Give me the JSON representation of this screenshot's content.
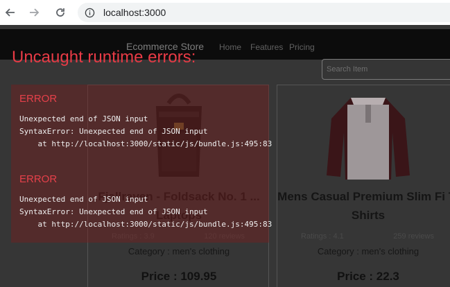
{
  "browser": {
    "url": "localhost:3000"
  },
  "app": {
    "brand": "Ecommerce Store",
    "nav": [
      "Home",
      "Features",
      "Pricing"
    ],
    "search_placeholder": "Search Item",
    "products": [
      {
        "title": "Fjallraven - Foldsack No. 1 ... Laptops",
        "ratings": "Ratings : 3.9",
        "reviews": "120 reviews",
        "category": "Category : men's clothing",
        "price": "Price : 109.95"
      },
      {
        "title": "Mens Casual Premium Slim Fi T-Shirts",
        "ratings": "Ratings : 4.1",
        "reviews": "259 reviews",
        "category": "Category : men's clothing",
        "price": "Price : 22.3"
      }
    ]
  },
  "overlay": {
    "title": "Uncaught runtime errors:",
    "errors": [
      {
        "label": "ERROR",
        "lines": [
          "Unexpected end of JSON input",
          "SyntaxError: Unexpected end of JSON input",
          "    at http://localhost:3000/static/js/bundle.js:495:83"
        ]
      },
      {
        "label": "ERROR",
        "lines": [
          "Unexpected end of JSON input",
          "SyntaxError: Unexpected end of JSON input",
          "    at http://localhost:3000/static/js/bundle.js:495:83"
        ]
      }
    ]
  }
}
